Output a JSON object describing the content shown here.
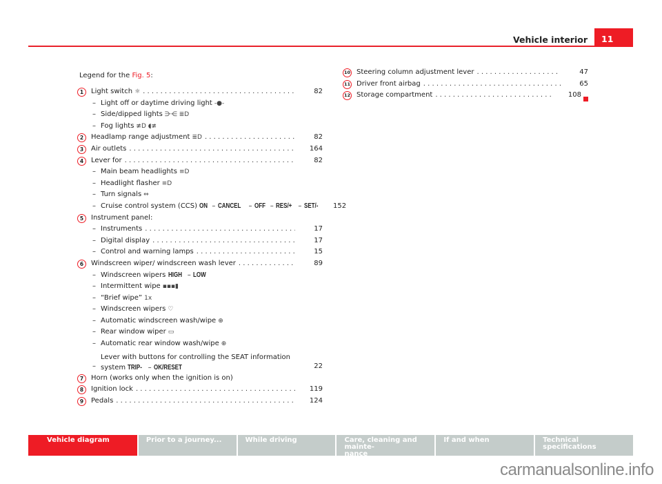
{
  "header": {
    "title": "Vehicle interior",
    "page_number": "11"
  },
  "legend": {
    "intro_prefix": "Legend for the ",
    "fig_ref": "Fig. 5",
    "intro_suffix": ":"
  },
  "left_items": [
    {
      "num": "1",
      "label": "Light switch",
      "icon": "☼",
      "page": "82",
      "subs": [
        {
          "label": "Light off or daytime driving light",
          "icon": "-●-"
        },
        {
          "label": "Side/dipped lights",
          "icon": "⋺⋲ ≣D"
        },
        {
          "label": "Fog lights",
          "icon": "≢D ◖≢"
        }
      ]
    },
    {
      "num": "2",
      "label": "Headlamp range adjustment",
      "icon": "≣D",
      "page": "82"
    },
    {
      "num": "3",
      "label": "Air outlets",
      "page": "164"
    },
    {
      "num": "4",
      "label": "Lever for",
      "page": "82",
      "subs": [
        {
          "label": "Main beam headlights",
          "icon": "≡D"
        },
        {
          "label": "Headlight flasher",
          "icon": "≡D"
        },
        {
          "label": "Turn signals",
          "icon": "⇔"
        },
        {
          "label": "Cruise control system (CCS)",
          "buttons": [
            "ON",
            "CANCEL",
            "OFF",
            "RES/+",
            "SET/-"
          ],
          "page": "152"
        }
      ]
    },
    {
      "num": "5",
      "label": "Instrument panel:",
      "subs": [
        {
          "label": "Instruments",
          "page": "17"
        },
        {
          "label": "Digital display",
          "page": "17"
        },
        {
          "label": "Control and warning lamps",
          "page": "15"
        }
      ]
    },
    {
      "num": "6",
      "label": "Windscreen wiper/ windscreen wash lever",
      "page": "89",
      "subs": [
        {
          "label": "Windscreen wipers",
          "buttons": [
            "HIGH",
            "LOW"
          ]
        },
        {
          "label": "Intermittent wipe",
          "icon": "▪▪▪▮"
        },
        {
          "label": "“Brief wipe”",
          "icon": "1x"
        },
        {
          "label": "Windscreen wipers",
          "icon": "♡"
        },
        {
          "label": "Automatic windscreen wash/wipe",
          "icon": "⊕"
        },
        {
          "label": "Rear window wiper",
          "icon": "▭"
        },
        {
          "label": "Automatic rear window wash/wipe",
          "icon": "⊕"
        },
        {
          "label": "Lever with buttons for controlling the SEAT information system",
          "buttons": [
            "TRIP-",
            "OK/RESET"
          ],
          "page": "22"
        }
      ]
    },
    {
      "num": "7",
      "label": "Horn (works only when the ignition is on)"
    },
    {
      "num": "8",
      "label": "Ignition lock",
      "page": "119"
    },
    {
      "num": "9",
      "label": "Pedals",
      "page": "124"
    }
  ],
  "right_items": [
    {
      "num": "10",
      "label": "Steering column adjustment lever",
      "page": "47"
    },
    {
      "num": "11",
      "label": "Driver front airbag",
      "page": "65"
    },
    {
      "num": "12",
      "label": "Storage compartment",
      "page": "108"
    }
  ],
  "footer_tabs": [
    {
      "label": "Vehicle diagram",
      "active": true
    },
    {
      "label": "Prior to a journey..."
    },
    {
      "label": "While driving"
    },
    {
      "label": "Care, cleaning and mainte-\nnance"
    },
    {
      "label": "If and when"
    },
    {
      "label": "Technical specifications"
    }
  ],
  "watermark": "carmanualsonline.info",
  "colors": {
    "accent": "#ee1c25",
    "tab_inactive": "#c4ccca"
  }
}
